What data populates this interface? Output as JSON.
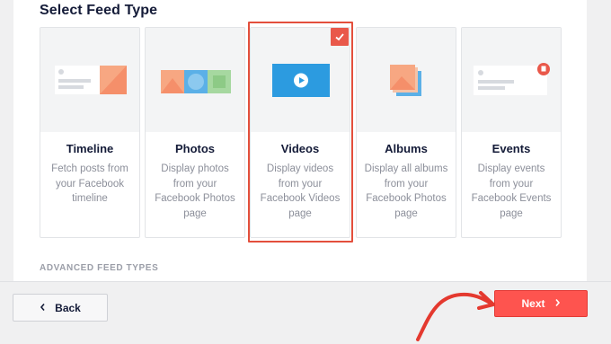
{
  "section_title": "Select Feed Type",
  "feed_types": [
    {
      "name": "Timeline",
      "desc": "Fetch posts from your Facebook timeline",
      "icon": "timeline-illustration-icon",
      "selected": false
    },
    {
      "name": "Photos",
      "desc": "Display photos from your Facebook Photos page",
      "icon": "photos-illustration-icon",
      "selected": false
    },
    {
      "name": "Videos",
      "desc": "Display videos from your Facebook Videos page",
      "icon": "videos-illustration-icon",
      "selected": true
    },
    {
      "name": "Albums",
      "desc": "Display all albums from your Facebook Photos page",
      "icon": "albums-illustration-icon",
      "selected": false
    },
    {
      "name": "Events",
      "desc": "Display events from your Facebook Events page",
      "icon": "events-illustration-icon",
      "selected": false
    }
  ],
  "advanced_label": "ADVANCED FEED TYPES",
  "footer": {
    "back_label": "Back",
    "next_label": "Next"
  },
  "colors": {
    "accent": "#fe544f",
    "selection_outline": "#e34f3c",
    "video_blue": "#2c9be0",
    "orange": "#f7a782",
    "green": "#a6d8a0"
  }
}
